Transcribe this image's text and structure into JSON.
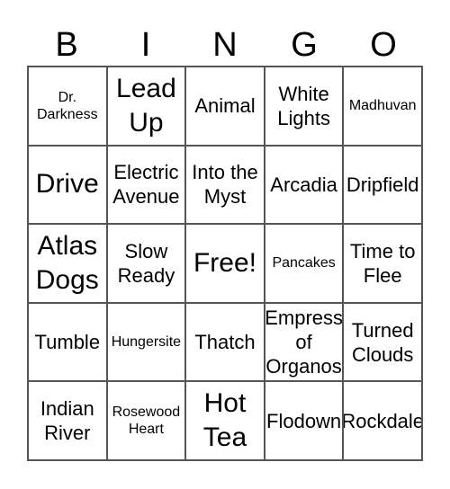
{
  "header": [
    "B",
    "I",
    "N",
    "G",
    "O"
  ],
  "cells": [
    {
      "text": "Dr. Darkness",
      "size": "s"
    },
    {
      "text": "Lead Up",
      "size": "l"
    },
    {
      "text": "Animal",
      "size": "m"
    },
    {
      "text": "White Lights",
      "size": "m"
    },
    {
      "text": "Madhuvan",
      "size": "s"
    },
    {
      "text": "Drive",
      "size": "l"
    },
    {
      "text": "Electric Avenue",
      "size": "m"
    },
    {
      "text": "Into the Myst",
      "size": "m"
    },
    {
      "text": "Arcadia",
      "size": "m"
    },
    {
      "text": "Dripfield",
      "size": "m"
    },
    {
      "text": "Atlas Dogs",
      "size": "l"
    },
    {
      "text": "Slow Ready",
      "size": "m"
    },
    {
      "text": "Free!",
      "size": "l"
    },
    {
      "text": "Pancakes",
      "size": "s"
    },
    {
      "text": "Time to Flee",
      "size": "m"
    },
    {
      "text": "Tumble",
      "size": "m"
    },
    {
      "text": "Hungersite",
      "size": "s"
    },
    {
      "text": "Thatch",
      "size": "m"
    },
    {
      "text": "Empress of Organos",
      "size": "m"
    },
    {
      "text": "Turned Clouds",
      "size": "m"
    },
    {
      "text": "Indian River",
      "size": "m"
    },
    {
      "text": "Rosewood Heart",
      "size": "s"
    },
    {
      "text": "Hot Tea",
      "size": "l"
    },
    {
      "text": "Flodown",
      "size": "m"
    },
    {
      "text": "Rockdale",
      "size": "m"
    }
  ]
}
